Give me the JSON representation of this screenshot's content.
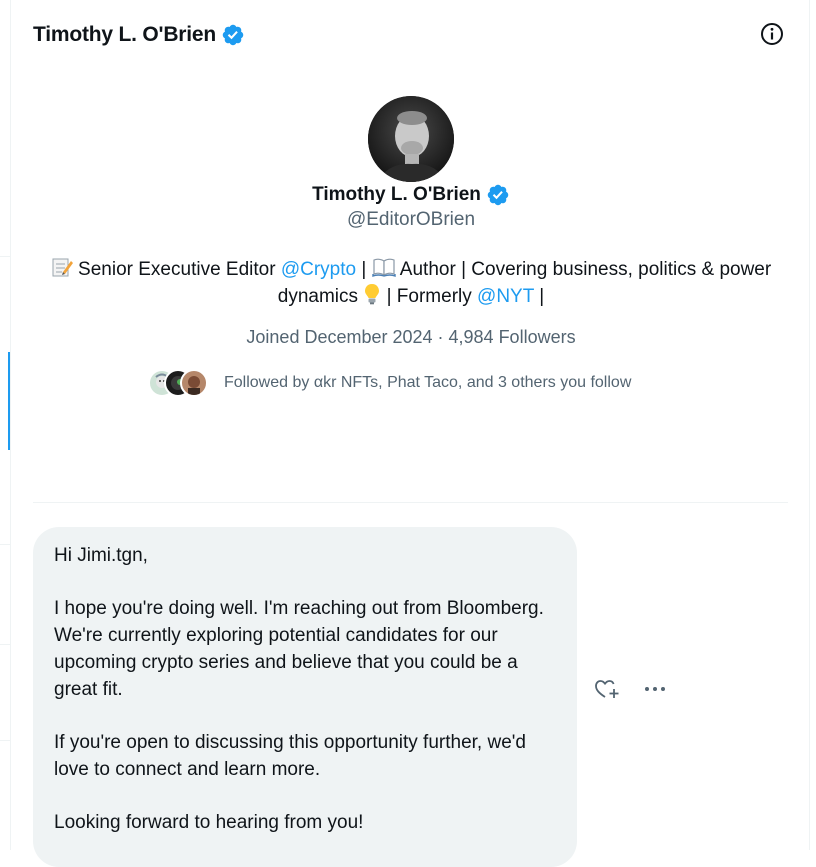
{
  "header": {
    "name": "Timothy L. O'Brien",
    "info_icon": "info-icon",
    "verified_icon": "verified-badge-icon"
  },
  "profile": {
    "avatar_icon": "avatar",
    "name": "Timothy L. O'Brien",
    "handle": "@EditorOBrien",
    "bio": {
      "part1": " Senior Executive Editor ",
      "mention1": "@Crypto",
      "part2": " | ",
      "part3": " Author | Covering business, politics & power dynamics ",
      "part4": " | Formerly ",
      "mention2": "@NYT",
      "part5": " |"
    },
    "joined": "Joined December 2024 · 4,984 Followers",
    "followed_by": "Followed by αkr NFTs, Phat Taco, and 3 others you follow"
  },
  "message": {
    "paragraphs": [
      "Hi Jimi.tgn,",
      "I hope you're doing well. I'm reaching out from Bloomberg. We're currently exploring potential candidates for our upcoming crypto series and believe that you could be a great fit.",
      "If you're open to discussing this opportunity further, we'd love to connect and learn more.",
      "Looking forward to hearing from you!"
    ],
    "react_icon": "heart-plus-icon",
    "more_icon": "more-dots-icon"
  },
  "colors": {
    "accent": "#1d9bf0",
    "secondary_text": "#536471",
    "bubble_bg": "#eff3f4"
  }
}
